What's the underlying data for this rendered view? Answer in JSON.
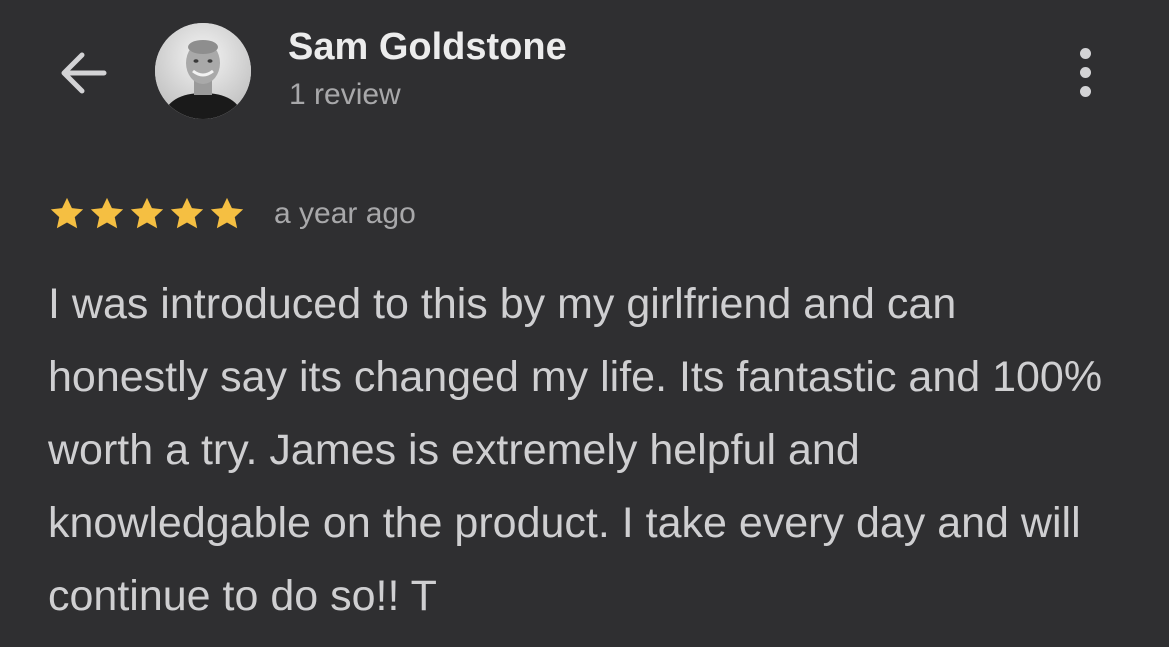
{
  "header": {
    "reviewer_name": "Sam Goldstone",
    "review_count": "1 review",
    "back_icon": "arrow-left-icon",
    "more_icon": "more-vert-icon"
  },
  "review": {
    "rating": 5,
    "max_rating": 5,
    "time": "a year ago",
    "text": "I was introduced to this by my girlfriend and can honestly say its changed my life. Its fantastic and 100% worth a try. James is extremely helpful and knowledgable on the product. I take every day and will continue to do so!! T"
  },
  "colors": {
    "background": "#2f2f31",
    "star": "#f5bf42",
    "name": "#ececec",
    "secondary_text": "#a8a8aa",
    "body_text": "#cfcfd1"
  }
}
